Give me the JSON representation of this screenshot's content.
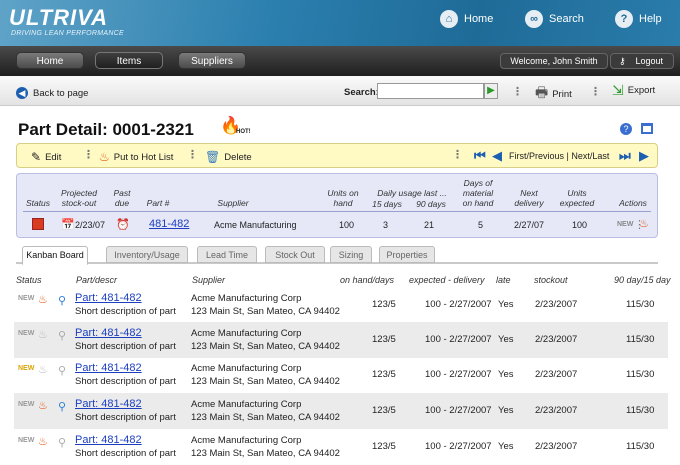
{
  "brand": {
    "name": "ULTRIVA",
    "tagline": "DRIVING LEAN PERFORMANCE"
  },
  "top_nav": [
    {
      "label": "Home",
      "icon": "home-icon"
    },
    {
      "label": "Search",
      "icon": "binoculars-icon"
    },
    {
      "label": "Help",
      "icon": "question-icon"
    }
  ],
  "main_tabs": [
    "Home",
    "Items",
    "Suppliers"
  ],
  "selected_main_tab": "Items",
  "welcome": "Welcome, John Smith",
  "logout": "Logout",
  "back": "Back to page",
  "search": {
    "label": "Search:",
    "value": ""
  },
  "actions": {
    "print": "Print",
    "export": "Export"
  },
  "title": "Part Detail: 0001-2321",
  "hot_label": "HOT!",
  "toolbar": {
    "edit": "Edit",
    "hot_list": "Put to Hot List",
    "delete": "Delete",
    "pager": "First/Previous | Next/Last"
  },
  "detail": {
    "headers": {
      "status": "Status",
      "projected": "Projected stock-out",
      "past_due": "Past due",
      "part": "Part #",
      "supplier": "Supplier",
      "units_on_hand": "Units on hand",
      "daily_usage": "Daily usage last ...",
      "d15": "15 days",
      "d90": "90 days",
      "days_material": "Days of material on hand",
      "next_delivery": "Next delivery",
      "units_expected": "Units expected",
      "actions": "Actions"
    },
    "values": {
      "projected": "2/23/07",
      "part": "481-482",
      "supplier": "Acme Manufacturing",
      "units_on_hand": "100",
      "d15": "3",
      "d90": "21",
      "days_material": "5",
      "next_delivery": "2/27/07",
      "units_expected": "100"
    }
  },
  "sub_tabs": [
    "Kanban Board",
    "Inventory/Usage",
    "Lead Time",
    "Stock Out",
    "Sizing",
    "Properties"
  ],
  "list_headers": {
    "status": "Status",
    "part": "Part/descr",
    "supplier": "Supplier",
    "onhand": "on hand/days",
    "expected": "expected - delivery",
    "late": "late",
    "stockout": "stockout",
    "usage": "90 day/15 day"
  },
  "rows": [
    {
      "part": "Part: 481-482",
      "desc": "Short description of part",
      "supplier": "Acme Manufacturing Corp",
      "address": "123 Main St, San Mateo, CA 94402",
      "onhand": "123/5",
      "expected": "100 - 2/27/2007",
      "late": "Yes",
      "stockout": "2/23/2007",
      "usage": "115/30",
      "new_active": false,
      "hot": true,
      "pin": true
    },
    {
      "part": "Part: 481-482",
      "desc": "Short description of part",
      "supplier": "Acme Manufacturing Corp",
      "address": "123 Main St, San Mateo, CA 94402",
      "onhand": "123/5",
      "expected": "100 - 2/27/2007",
      "late": "Yes",
      "stockout": "2/23/2007",
      "usage": "115/30",
      "new_active": false,
      "hot": false,
      "pin": false
    },
    {
      "part": "Part: 481-482",
      "desc": "Short description of part",
      "supplier": "Acme Manufacturing Corp",
      "address": "123 Main St, San Mateo, CA 94402",
      "onhand": "123/5",
      "expected": "100 - 2/27/2007",
      "late": "Yes",
      "stockout": "2/23/2007",
      "usage": "115/30",
      "new_active": true,
      "hot": false,
      "pin": false
    },
    {
      "part": "Part: 481-482",
      "desc": "Short description of part",
      "supplier": "Acme Manufacturing Corp",
      "address": "123 Main St, San Mateo, CA 94402",
      "onhand": "123/5",
      "expected": "100 - 2/27/2007",
      "late": "Yes",
      "stockout": "2/23/2007",
      "usage": "115/30",
      "new_active": false,
      "hot": true,
      "pin": true
    },
    {
      "part": "Part: 481-482",
      "desc": "Short description of part",
      "supplier": "Acme Manufacturing Corp",
      "address": "123 Main St, San Mateo, CA 94402",
      "onhand": "123/5",
      "expected": "100 - 2/27/2007",
      "late": "Yes",
      "stockout": "2/23/2007",
      "usage": "115/30",
      "new_active": false,
      "hot": true,
      "pin": false
    }
  ],
  "new_badge": "NEW",
  "colors": {
    "header_blue": "#2b7fae",
    "toolbar_yellow": "#fff9c4",
    "detail_lavender": "#e6e8f8",
    "link_blue": "#1c3fc0",
    "hot_orange": "#e5540a"
  }
}
